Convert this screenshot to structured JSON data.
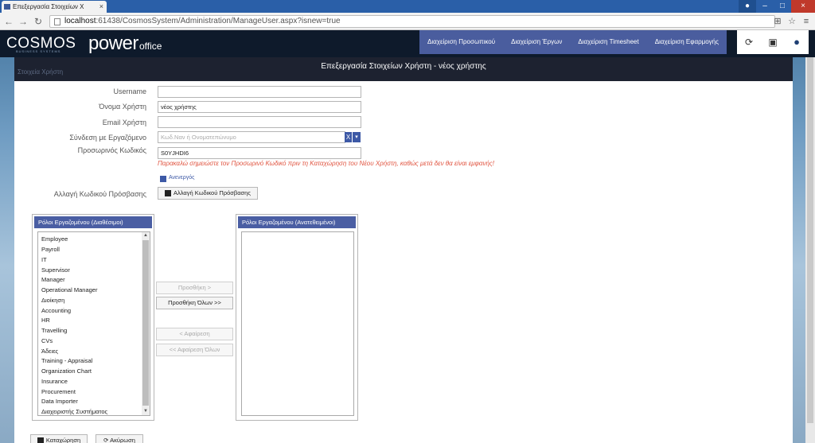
{
  "browser": {
    "tab_title": "Επεξεργασία Στοιχείων Χ",
    "tab_close": "×",
    "url_host": "localhost",
    "url_rest": ":61438/CosmosSystem/Administration/ManageUser.aspx?isnew=true",
    "back": "←",
    "forward": "→",
    "reload": "↻",
    "star": "☆",
    "menu": "≡",
    "translate": "⊞",
    "win_user": "●",
    "win_min": "–",
    "win_max": "□",
    "win_close": "×"
  },
  "brand": {
    "cosmos": "COSMOS",
    "cosmos_sub": "BUSINESS SYSTEMS",
    "power": "power",
    "office": "office"
  },
  "topnav": [
    "Διαχείριση Προσωπικού",
    "Διαχείριση Έργων",
    "Διαχείριση Timesheet",
    "Διαχείριση Εφαρμογής"
  ],
  "header_icons": {
    "refresh": "⟳",
    "window": "▣",
    "user": "●"
  },
  "panel": {
    "subtitle": "Στοιχεία Χρήστη",
    "title": "Επεξεργασία Στοιχείων Χρήστη - νέος χρήστης"
  },
  "form": {
    "username_label": "Username",
    "username_value": "",
    "fullname_label": "Όνομα Χρήστη",
    "fullname_value": "νέος χρήστης",
    "email_label": "Email Χρήστη",
    "email_value": "",
    "employee_label": "Σύνδεση με Εργαζόμενο",
    "employee_placeholder": "Κωδ.Ναν ή Ονοματεπώνυμο",
    "clear_btn": "X",
    "dropdown_btn": "▾",
    "temp_pass_label": "Προσωρινός Κωδικός",
    "temp_pass_value": "S0YJHDI6",
    "warning": "Παρακαλώ σημειώστε τον Προσωρινό Κωδικό πριν τη Καταχώρηση του Νέου Χρήστη, καθώς μετά δεν θα είναι εμφανής!",
    "inactive_label": "Ανενεργός",
    "change_pass_label": "Αλλαγή Κωδικού Πρόσβασης",
    "change_pass_button": "Αλλαγή Κωδικού Πρόσβασης"
  },
  "roles": {
    "available_title": "Ρόλοι Εργαζομένου (Διαθέσιμοι)",
    "assigned_title": "Ρόλοι Εργαζομένου (Ανατεθειμένοι)",
    "available": [
      "Employee",
      "Payroll",
      "IT",
      "Supervisor",
      "Manager",
      "Operational Manager",
      "Διοίκηση",
      "Accounting",
      "HR",
      "Travelling",
      "CVs",
      "Άδειες",
      "Training - Appraisal",
      "Organization Chart",
      "Insurance",
      "Procurement",
      "Data Importer",
      "Διαχειριστής Συστήματος"
    ],
    "assigned": [],
    "add": "Προσθήκη >",
    "add_all": "Προσθήκη Όλων >>",
    "remove": "< Αφαίρεση",
    "remove_all": "<< Αφαίρεση Όλων",
    "scroll_up": "▲",
    "scroll_down": "▼"
  },
  "footer": {
    "save": "Καταχώρηση",
    "cancel": "Ακύρωση"
  }
}
